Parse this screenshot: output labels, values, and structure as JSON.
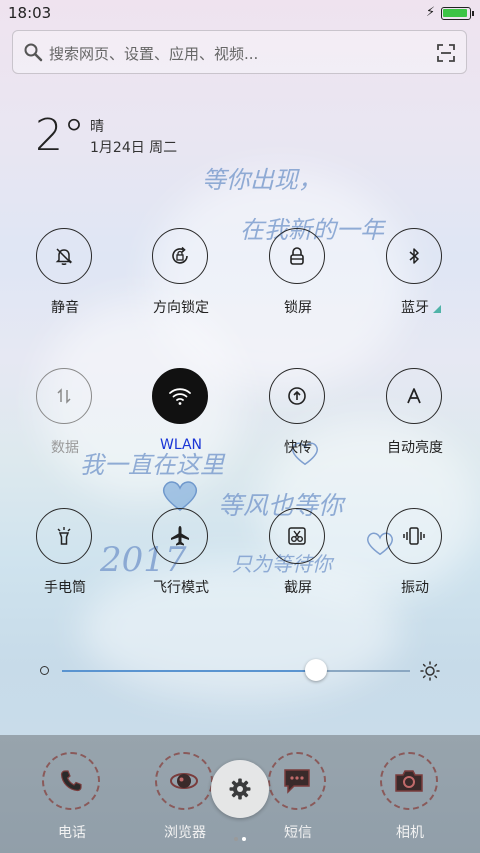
{
  "status": {
    "time": "18:03",
    "charging_icon": "bolt-icon",
    "battery_color": "#3cc445"
  },
  "search": {
    "placeholder": "搜索网页、设置、应用、视频..."
  },
  "weather": {
    "temperature": "2°",
    "condition": "晴",
    "date": "1月24日 周二"
  },
  "toggles": [
    {
      "label": "静音",
      "icon": "bell-off-icon",
      "state": "off"
    },
    {
      "label": "方向锁定",
      "icon": "rotation-lock-icon",
      "state": "off"
    },
    {
      "label": "锁屏",
      "icon": "lock-icon",
      "state": "off"
    },
    {
      "label": "蓝牙",
      "icon": "bluetooth-icon",
      "state": "off"
    },
    {
      "label": "数据",
      "icon": "mobile-data-icon",
      "state": "disabled"
    },
    {
      "label": "WLAN",
      "icon": "wifi-icon",
      "state": "on"
    },
    {
      "label": "快传",
      "icon": "quick-share-icon",
      "state": "off"
    },
    {
      "label": "自动亮度",
      "icon": "auto-brightness-icon",
      "state": "off"
    },
    {
      "label": "手电筒",
      "icon": "flashlight-icon",
      "state": "off"
    },
    {
      "label": "飞行模式",
      "icon": "airplane-icon",
      "state": "off"
    },
    {
      "label": "截屏",
      "icon": "screenshot-icon",
      "state": "off"
    },
    {
      "label": "振动",
      "icon": "vibrate-icon",
      "state": "off"
    }
  ],
  "brightness": {
    "level": 0.73
  },
  "dock": [
    {
      "label": "电话",
      "icon": "phone-icon"
    },
    {
      "label": "浏览器",
      "icon": "browser-icon"
    },
    {
      "label": "短信",
      "icon": "message-icon"
    },
    {
      "label": "相机",
      "icon": "camera-icon"
    }
  ],
  "settings_button": {
    "icon": "gear-icon"
  },
  "page_indicator": {
    "count": 2,
    "active": 2
  },
  "wallpaper_text": {
    "line1": "等你出现，",
    "line2": "在我新的一年",
    "line3": "我一直在这里",
    "line4": "等风也等你",
    "line5": "2017",
    "line6": "只为等待你"
  }
}
